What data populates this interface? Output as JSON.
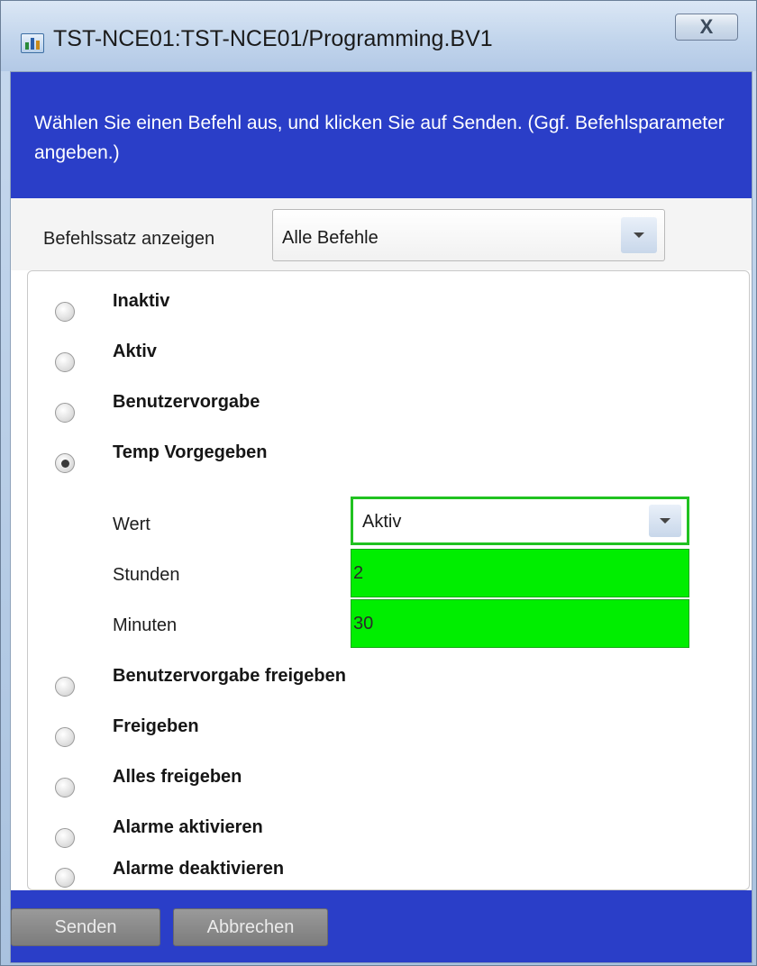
{
  "window": {
    "title": "TST-NCE01:TST-NCE01/Programming.BV1",
    "close_label": "X"
  },
  "banner": {
    "instruction": "Wählen Sie einen Befehl aus, und klicken Sie auf Senden. (Ggf. Befehlsparameter angeben.)"
  },
  "command_set": {
    "label": "Befehlssatz anzeigen",
    "selected": "Alle Befehle"
  },
  "options": [
    {
      "label": "Inaktiv",
      "checked": false
    },
    {
      "label": "Aktiv",
      "checked": false
    },
    {
      "label": "Benutzervorgabe",
      "checked": false
    },
    {
      "label": "Temp Vorgegeben",
      "checked": true
    },
    {
      "label": "Benutzervorgabe freigeben",
      "checked": false
    },
    {
      "label": "Freigeben",
      "checked": false
    },
    {
      "label": "Alles freigeben",
      "checked": false
    },
    {
      "label": "Alarme aktivieren",
      "checked": false
    },
    {
      "label": "Alarme deaktivieren",
      "checked": false
    }
  ],
  "parameters": {
    "wert": {
      "label": "Wert",
      "value": "Aktiv"
    },
    "stunden": {
      "label": "Stunden",
      "value": "2"
    },
    "minuten": {
      "label": "Minuten",
      "value": "30"
    }
  },
  "buttons": {
    "send": "Senden",
    "cancel": "Abbrechen"
  },
  "colors": {
    "banner": "#2a3ec8",
    "param_field_valid": "#00ee00"
  }
}
